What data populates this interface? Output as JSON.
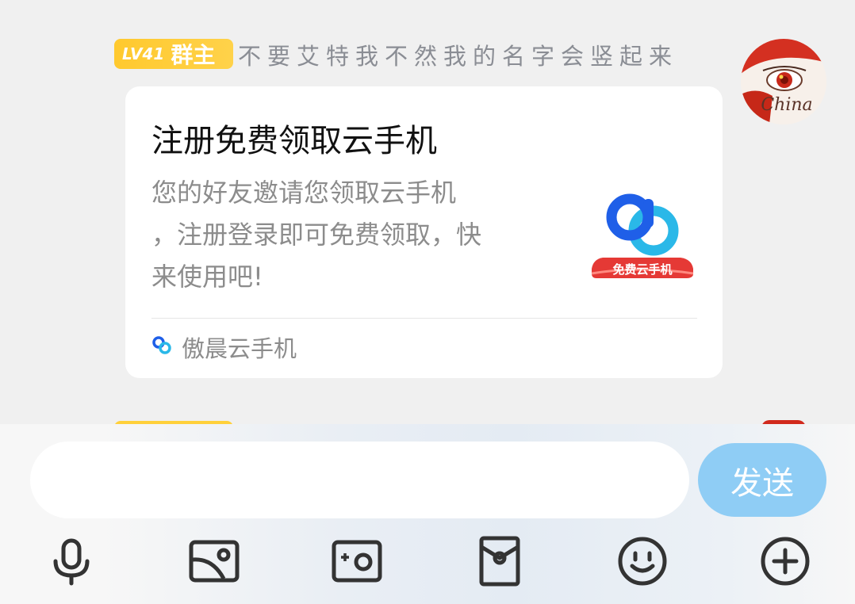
{
  "message": {
    "badge": {
      "level": "LV41",
      "role": "群主",
      "color": "#ffc92e"
    },
    "sender_name": "不要艾特我不然我的名字会竖起来",
    "avatar": {
      "text": "China"
    }
  },
  "card": {
    "title": "注册免费领取云手机",
    "description_lines": [
      "您的好友邀请您领取云手机",
      "，注册登录即可免费领取，快",
      "来使用吧!"
    ],
    "thumbnail_banner": "免费云手机",
    "source_icon": "link-logo-icon",
    "source_name": "傲晨云手机"
  },
  "input_bar": {
    "input_value": "",
    "send_label": "发送",
    "send_color": "#8fcdf5",
    "tools": [
      "microphone-icon",
      "image-icon",
      "camera-icon",
      "red-packet-icon",
      "emoji-icon",
      "plus-icon"
    ]
  }
}
